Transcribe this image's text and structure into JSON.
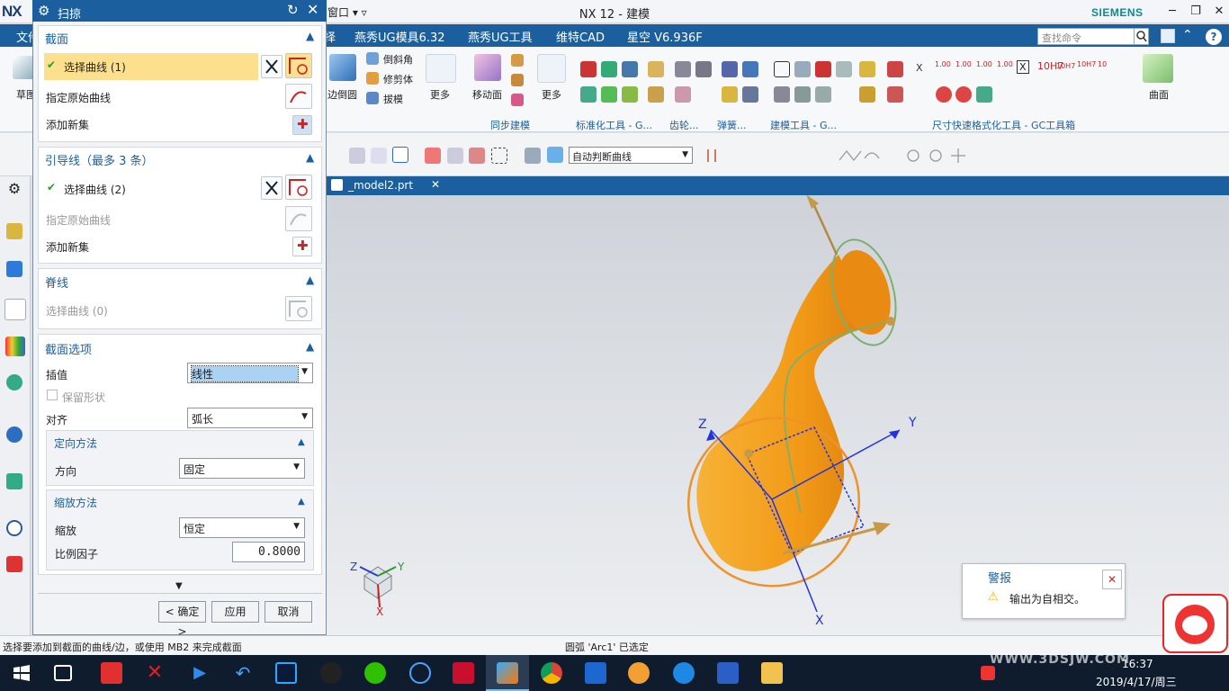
{
  "window": {
    "logo": "NX",
    "menu": "窗口 ▾ ▿",
    "title": "NX 12 - 建模",
    "brand": "SIEMENS",
    "controls": {
      "minimize": "─",
      "restore": "❐",
      "close": "✕"
    }
  },
  "menubar": {
    "items": [
      "文件",
      "择",
      "燕秀UG模具6.32",
      "燕秀UG工具",
      "维特CAD",
      "星空 V6.936F"
    ],
    "search_placeholder": "查找命令"
  },
  "ribbon": {
    "left_label": "草图",
    "items": {
      "edge_blend": "边倒圆",
      "chamfer": "倒斜角",
      "trim_body": "修剪体",
      "draft": "拔模",
      "more1": "更多",
      "move_face": "移动面",
      "more2": "更多",
      "more3": "更多",
      "surface": "曲面"
    },
    "groups": {
      "sync": "同步建模",
      "std": "标准化工具 - G...",
      "gear": "齿轮...",
      "spring": "弹簧...",
      "model": "建模工具 - G...",
      "dim": "尺寸快速格式化工具 - GC工具箱"
    },
    "tol_labels": [
      "X",
      "1.00",
      "1.00",
      "1.00",
      "1.00",
      "X",
      "10H7",
      "10H7",
      "10H7",
      "10"
    ]
  },
  "toolbar2": {
    "selection_filter": "自动判断曲线"
  },
  "graphics": {
    "tab": "_model2.prt",
    "axes": {
      "x": "X",
      "y": "Y",
      "z": "Z"
    },
    "triad": {
      "x": "X",
      "y": "Y",
      "z": "Z"
    }
  },
  "dialog": {
    "title": "扫掠",
    "section": {
      "header": "截面",
      "select_curve": "选择曲线 (1)",
      "specify_origin": "指定原始曲线",
      "add_new": "添加新集"
    },
    "guide": {
      "header": "引导线（最多 3 条）",
      "select_curve": "选择曲线 (2)",
      "specify_origin": "指定原始曲线",
      "add_new": "添加新集"
    },
    "spine": {
      "header": "脊线",
      "select_curve": "选择曲线 (0)"
    },
    "options": {
      "header": "截面选项",
      "interpolation_label": "插值",
      "interpolation_value": "线性",
      "preserve_shape": "保留形状",
      "alignment_label": "对齐",
      "alignment_value": "弧长",
      "orientation_header": "定向方法",
      "direction_label": "方向",
      "direction_value": "固定",
      "scaling_header": "缩放方法",
      "scale_label": "缩放",
      "scale_value": "恒定",
      "scale_factor_label": "比例因子",
      "scale_factor_value": "0.8000"
    },
    "buttons": {
      "ok": "< 确定 >",
      "apply": "应用",
      "cancel": "取消"
    }
  },
  "alert": {
    "title": "警报",
    "message": "输出为自相交。"
  },
  "status": {
    "left": "选择要添加到截面的曲线/边，或使用 MB2 来完成截面",
    "center": "圆弧 'Arc1' 已选定"
  },
  "taskbar": {
    "time": "16:37",
    "date": "2019/4/17/周三",
    "watermark": "WWW.3DSJW.COM"
  },
  "colors": {
    "accent": "#1b5f9e",
    "body": "#f4a020",
    "highlight": "#fde08e",
    "orange_circle": "#f0922a"
  }
}
